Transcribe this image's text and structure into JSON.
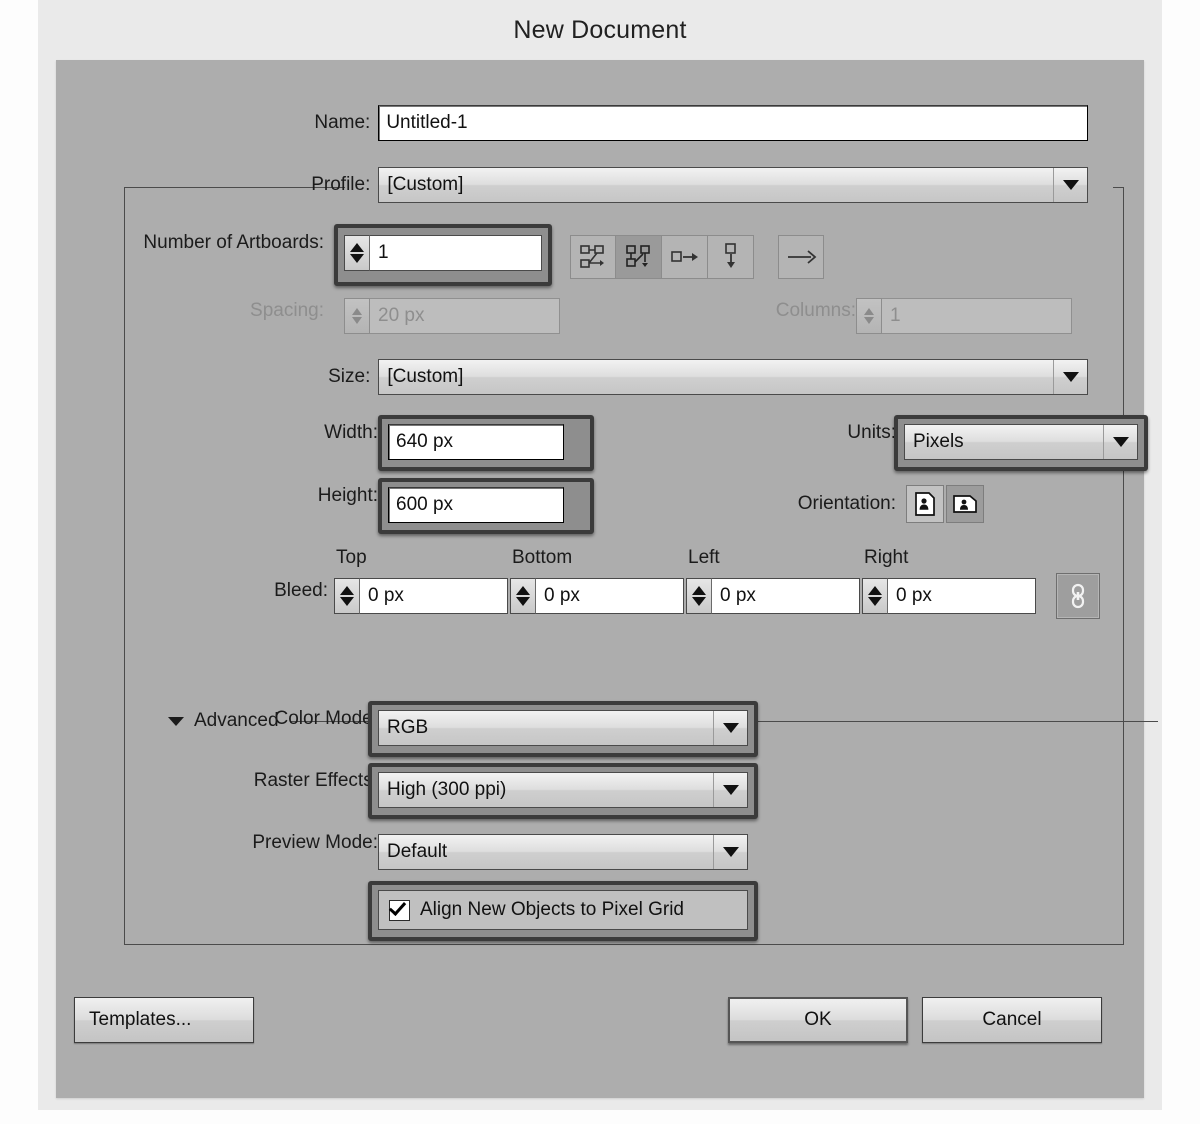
{
  "window": {
    "title": "New Document"
  },
  "fields": {
    "name_label": "Name:",
    "name_value": "Untitled-1",
    "profile_label": "Profile:",
    "profile_value": "[Custom]",
    "artboards_label": "Number of Artboards:",
    "artboards_value": "1",
    "spacing_label": "Spacing:",
    "spacing_value": "20 px",
    "columns_label": "Columns:",
    "columns_value": "1",
    "size_label": "Size:",
    "size_value": "[Custom]",
    "width_label": "Width:",
    "width_value": "640 px",
    "height_label": "Height:",
    "height_value": "600 px",
    "units_label": "Units:",
    "units_value": "Pixels",
    "orientation_label": "Orientation:",
    "bleed_label": "Bleed:",
    "bleed_top_label": "Top",
    "bleed_top_value": "0 px",
    "bleed_bottom_label": "Bottom",
    "bleed_bottom_value": "0 px",
    "bleed_left_label": "Left",
    "bleed_left_value": "0 px",
    "bleed_right_label": "Right",
    "bleed_right_value": "0 px"
  },
  "advanced": {
    "section_label": "Advanced",
    "color_mode_label": "Color Mode:",
    "color_mode_value": "RGB",
    "raster_effects_label": "Raster Effects:",
    "raster_effects_value": "High (300 ppi)",
    "preview_mode_label": "Preview Mode:",
    "preview_mode_value": "Default",
    "align_pixel_grid_label": "Align New Objects to Pixel Grid"
  },
  "buttons": {
    "templates": "Templates...",
    "ok": "OK",
    "cancel": "Cancel"
  },
  "icons": {
    "artboard_grid_by_row": "grid-by-row-icon",
    "artboard_grid_by_column": "grid-by-column-icon",
    "artboard_arrange_by_row": "arrange-by-row-icon",
    "artboard_arrange_by_column": "arrange-by-column-icon",
    "artboard_direction": "layout-direction-icon",
    "orientation_portrait": "portrait-icon",
    "orientation_landscape": "landscape-icon",
    "bleed_link": "link-chain-icon",
    "dropdown": "chevron-down-icon",
    "spinner_up": "spinner-up-icon",
    "spinner_down": "spinner-down-icon",
    "disclosure": "triangle-down-icon",
    "checkmark": "check-icon"
  },
  "colors": {
    "page_background": "#fdfdfd",
    "window_chrome": "#eaeaea",
    "dialog_background": "#adadad",
    "field_background": "#ffffff",
    "text": "#1b1b1b",
    "disabled_text": "#8e8e8e",
    "highlight_ring": "#3b3b3b"
  }
}
